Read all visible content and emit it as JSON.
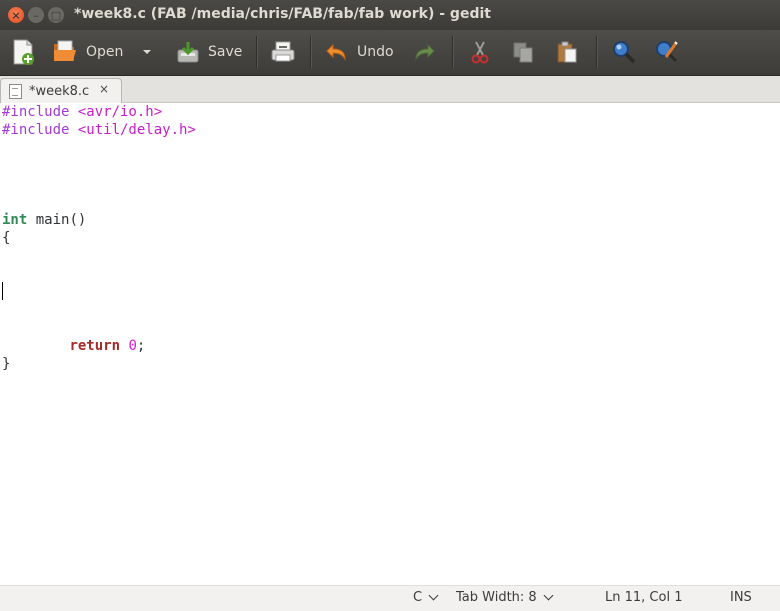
{
  "window": {
    "title": "*week8.c (FAB /media/chris/FAB/fab/fab work) - gedit",
    "controls": [
      "close-icon",
      "minimize-icon",
      "maximize-icon"
    ]
  },
  "toolbar": {
    "new_icon": "new-document-icon",
    "open_label": "Open",
    "save_label": "Save",
    "undo_label": "Undo",
    "icons": [
      "new-document-icon",
      "open-folder-icon",
      "dropdown-arrow-icon",
      "save-icon",
      "print-icon",
      "undo-icon",
      "redo-icon",
      "cut-icon",
      "copy-icon",
      "paste-icon",
      "find-icon",
      "find-replace-icon"
    ]
  },
  "tabs": [
    {
      "label": "*week8.c",
      "close": "×"
    }
  ],
  "editor": {
    "lines": [
      "#include <avr/io.h>",
      "#include <util/delay.h>",
      "",
      "",
      "",
      "int main()",
      "{",
      "",
      "",
      "",
      "",
      "",
      "\treturn 0;",
      "}"
    ],
    "l1_pre": "#include ",
    "l1_inc": "<avr/io.h>",
    "l2_pre": "#include ",
    "l2_inc": "<util/delay.h>",
    "l6_type": "int",
    "l6_rest": " main()",
    "l7": "{",
    "l13_indent": "        ",
    "l13_kw": "return",
    "l13_sp": " ",
    "l13_num": "0",
    "l13_end": ";",
    "l14": "}"
  },
  "statusbar": {
    "language": "C",
    "tab_width": "Tab Width: 8",
    "position": "Ln 11, Col 1",
    "mode": "INS"
  },
  "colors": {
    "titlebar": "#3c3b37",
    "close_button": "#df4a16",
    "preprocessor": "#a33ad6",
    "include_path": "#c81ec8",
    "keyword": "#a52a2a",
    "type": "#2e8b57",
    "number": "#d81ec8"
  }
}
